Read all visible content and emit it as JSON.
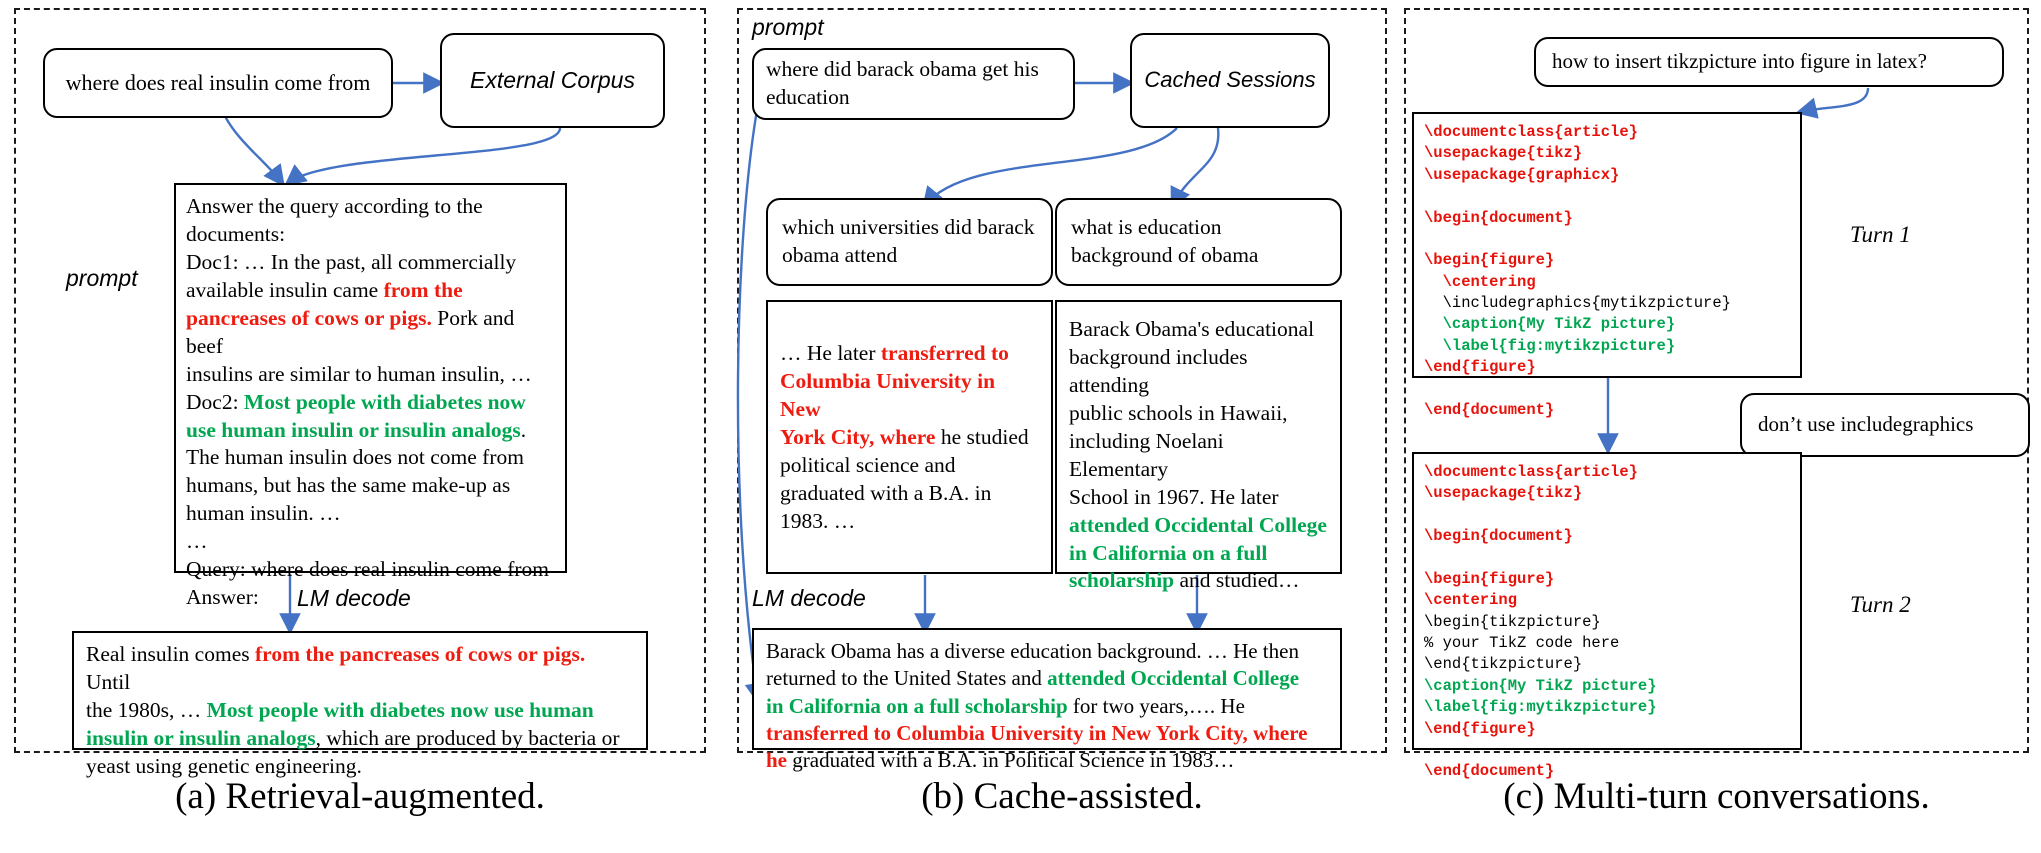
{
  "panels": {
    "a": {
      "caption": "(a) Retrieval-augmented.",
      "query_box": "where does real insulin come from",
      "corpus_box": "External Corpus",
      "prompt_label": "prompt",
      "decode_label": "LM decode",
      "prompt_lines": [
        {
          "parts": [
            {
              "t": "Answer the query according to the",
              "c": "plain"
            }
          ]
        },
        {
          "parts": [
            {
              "t": "documents:",
              "c": "plain"
            }
          ]
        },
        {
          "parts": [
            {
              "t": "Doc1: … In the past, all commercially",
              "c": "plain"
            }
          ]
        },
        {
          "parts": [
            {
              "t": "available insulin came ",
              "c": "plain"
            },
            {
              "t": "from the",
              "c": "red"
            }
          ]
        },
        {
          "parts": [
            {
              "t": "pancreases of cows or pigs.",
              "c": "red"
            },
            {
              "t": " Pork and beef",
              "c": "plain"
            }
          ]
        },
        {
          "parts": [
            {
              "t": "insulins are similar to human insulin, …",
              "c": "plain"
            }
          ]
        },
        {
          "parts": [
            {
              "t": "Doc2: ",
              "c": "plain"
            },
            {
              "t": "Most people with diabetes now",
              "c": "green"
            }
          ]
        },
        {
          "parts": [
            {
              "t": "use human insulin or insulin analogs",
              "c": "green"
            },
            {
              "t": ".",
              "c": "plain"
            }
          ]
        },
        {
          "parts": [
            {
              "t": "The human insulin does not come from",
              "c": "plain"
            }
          ]
        },
        {
          "parts": [
            {
              "t": "humans, but has the same make-up as",
              "c": "plain"
            }
          ]
        },
        {
          "parts": [
            {
              "t": "human insulin. …",
              "c": "plain"
            }
          ]
        },
        {
          "parts": [
            {
              "t": "…",
              "c": "plain"
            }
          ]
        },
        {
          "parts": [
            {
              "t": "Query: where does real insulin come from",
              "c": "plain"
            }
          ]
        },
        {
          "parts": [
            {
              "t": "Answer:",
              "c": "plain"
            }
          ]
        }
      ],
      "answer_lines": [
        {
          "parts": [
            {
              "t": "Real insulin comes ",
              "c": "plain"
            },
            {
              "t": "from the pancreases of cows or pigs.",
              "c": "red"
            },
            {
              "t": " Until",
              "c": "plain"
            }
          ]
        },
        {
          "parts": [
            {
              "t": "the 1980s, … ",
              "c": "plain"
            },
            {
              "t": "Most people with diabetes now use human",
              "c": "green"
            }
          ]
        },
        {
          "parts": [
            {
              "t": "insulin or insulin analogs",
              "c": "green"
            },
            {
              "t": ", which are produced by bacteria or",
              "c": "plain"
            }
          ]
        },
        {
          "parts": [
            {
              "t": "yeast using genetic engineering.",
              "c": "plain"
            }
          ]
        }
      ]
    },
    "b": {
      "caption": "(b) Cache-assisted.",
      "prompt_label": "prompt",
      "decode_label": "LM decode",
      "query_box": "where did barack obama get his education",
      "cache_box": "Cached Sessions",
      "session1_query": "which universities did barack obama attend",
      "session2_query": "what is education background of obama",
      "session1_answer_lines": [
        {
          "parts": [
            {
              "t": "… He later ",
              "c": "plain"
            },
            {
              "t": "transferred to",
              "c": "red"
            }
          ]
        },
        {
          "parts": [
            {
              "t": "Columbia University in New",
              "c": "red"
            }
          ]
        },
        {
          "parts": [
            {
              "t": "York City, where",
              "c": "red"
            },
            {
              "t": " he studied",
              "c": "plain"
            }
          ]
        },
        {
          "parts": [
            {
              "t": "political science and",
              "c": "plain"
            }
          ]
        },
        {
          "parts": [
            {
              "t": "graduated with a B.A. in",
              "c": "plain"
            }
          ]
        },
        {
          "parts": [
            {
              "t": "1983. …",
              "c": "plain"
            }
          ]
        }
      ],
      "session2_answer_lines": [
        {
          "parts": [
            {
              "t": "Barack Obama's educational",
              "c": "plain"
            }
          ]
        },
        {
          "parts": [
            {
              "t": "background includes attending",
              "c": "plain"
            }
          ]
        },
        {
          "parts": [
            {
              "t": "public schools in Hawaii,",
              "c": "plain"
            }
          ]
        },
        {
          "parts": [
            {
              "t": "including Noelani Elementary",
              "c": "plain"
            }
          ]
        },
        {
          "parts": [
            {
              "t": "School in 1967. He later",
              "c": "plain"
            }
          ]
        },
        {
          "parts": [
            {
              "t": "attended Occidental College",
              "c": "green"
            }
          ]
        },
        {
          "parts": [
            {
              "t": "in California on a full",
              "c": "green"
            }
          ]
        },
        {
          "parts": [
            {
              "t": "scholarship",
              "c": "green"
            },
            {
              "t": " and studied…",
              "c": "plain"
            }
          ]
        }
      ],
      "final_answer_lines": [
        {
          "parts": [
            {
              "t": "Barack Obama has a diverse education background. … He then",
              "c": "plain"
            }
          ]
        },
        {
          "parts": [
            {
              "t": "returned to the United States and ",
              "c": "plain"
            },
            {
              "t": "attended Occidental College",
              "c": "green"
            }
          ]
        },
        {
          "parts": [
            {
              "t": "in California on a full scholarship",
              "c": "green"
            },
            {
              "t": " for two years,…. He",
              "c": "plain"
            }
          ]
        },
        {
          "parts": [
            {
              "t": "transferred to Columbia University in New York City, where",
              "c": "red"
            }
          ]
        },
        {
          "parts": [
            {
              "t": "he",
              "c": "red"
            },
            {
              "t": " graduated with a B.A. in Political Science in 1983…",
              "c": "plain"
            }
          ]
        }
      ]
    },
    "c": {
      "caption": "(c) Multi-turn conversations.",
      "user_turn1": "how to insert tikzpicture into figure in latex?",
      "user_turn2": "don’t use includegraphics",
      "turn1_label": "Turn 1",
      "turn2_label": "Turn 2",
      "code1_lines": [
        [
          {
            "t": "\\documentclass{article}",
            "c": "kw"
          }
        ],
        [
          {
            "t": "\\usepackage{tikz}",
            "c": "kw"
          }
        ],
        [
          {
            "t": "\\usepackage{graphicx}",
            "c": "kw"
          }
        ],
        [
          {
            "t": "",
            "c": "pl"
          }
        ],
        [
          {
            "t": "\\begin{document}",
            "c": "kw"
          }
        ],
        [
          {
            "t": "",
            "c": "pl"
          }
        ],
        [
          {
            "t": "\\begin{figure}",
            "c": "kw"
          }
        ],
        [
          {
            "t": "  \\centering",
            "c": "kw"
          }
        ],
        [
          {
            "t": "  \\includegraphics{mytikzpicture}",
            "c": "pl"
          }
        ],
        [
          {
            "t": "  \\caption{My TikZ picture}",
            "c": "gr"
          }
        ],
        [
          {
            "t": "  \\label{fig:mytikzpicture}",
            "c": "gr"
          }
        ],
        [
          {
            "t": "\\end{figure}",
            "c": "kw"
          }
        ],
        [
          {
            "t": "",
            "c": "pl"
          }
        ],
        [
          {
            "t": "\\end{document}",
            "c": "kw"
          }
        ]
      ],
      "code2_lines": [
        [
          {
            "t": "\\documentclass{article}",
            "c": "kw"
          }
        ],
        [
          {
            "t": "\\usepackage{tikz}",
            "c": "kw"
          }
        ],
        [
          {
            "t": "",
            "c": "pl"
          }
        ],
        [
          {
            "t": "\\begin{document}",
            "c": "kw"
          }
        ],
        [
          {
            "t": "",
            "c": "pl"
          }
        ],
        [
          {
            "t": "\\begin{figure}",
            "c": "kw"
          }
        ],
        [
          {
            "t": "\\centering",
            "c": "kw"
          }
        ],
        [
          {
            "t": "\\begin{tikzpicture}",
            "c": "pl"
          }
        ],
        [
          {
            "t": "% your TikZ code here",
            "c": "pl"
          }
        ],
        [
          {
            "t": "\\end{tikzpicture}",
            "c": "pl"
          }
        ],
        [
          {
            "t": "\\caption{My TikZ picture}",
            "c": "gr"
          }
        ],
        [
          {
            "t": "\\label{fig:mytikzpicture}",
            "c": "gr"
          }
        ],
        [
          {
            "t": "\\end{figure}",
            "c": "kw"
          }
        ],
        [
          {
            "t": "",
            "c": "pl"
          }
        ],
        [
          {
            "t": "\\end{document}",
            "c": "kw"
          }
        ]
      ]
    }
  },
  "colors": {
    "red": "#ee1c10",
    "green": "#00a650",
    "arrow": "#4472c4",
    "border": "#000000"
  }
}
